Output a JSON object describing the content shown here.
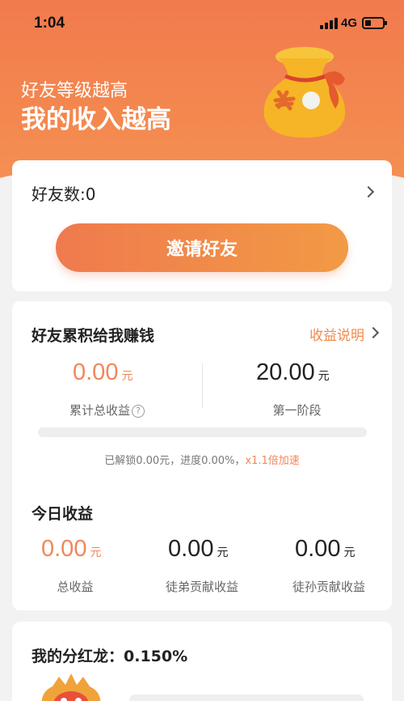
{
  "status_bar": {
    "time": "1:04",
    "network": "4G"
  },
  "hero": {
    "subtitle": "好友等级越高",
    "title": "我的收入越高"
  },
  "friends_card": {
    "friend_count_label": "好友数:0",
    "invite_button": "邀请好友"
  },
  "earnings_card": {
    "title": "好友累积给我赚钱",
    "explain_link": "收益说明",
    "total": {
      "value": "0.00",
      "unit": "元",
      "label": "累计总收益",
      "help": "?"
    },
    "stage": {
      "value": "20.00",
      "unit": "元",
      "label": "第一阶段"
    },
    "progress": {
      "fraction": 0.0,
      "note_prefix": "已解锁0.00元，进度0.00%，",
      "note_accent": "x1.1倍加速"
    },
    "today_title": "今日收益",
    "today": [
      {
        "value": "0.00",
        "unit": "元",
        "label": "总收益",
        "accent": true
      },
      {
        "value": "0.00",
        "unit": "元",
        "label": "徒弟贡献收益",
        "accent": false
      },
      {
        "value": "0.00",
        "unit": "元",
        "label": "徒孙贡献收益",
        "accent": false
      }
    ]
  },
  "dragon_card": {
    "title": "我的分红龙：",
    "value": "0.150%"
  },
  "colors": {
    "accent": "#f0875a",
    "hero_top": "#f27a4e",
    "hero_bottom": "#f59152",
    "bag_gold": "#f5b526"
  },
  "icons": {
    "bag": "money-bag-icon",
    "chevron": "chevron-right-icon",
    "help": "help-circle-icon",
    "dragon": "dragon-icon"
  }
}
